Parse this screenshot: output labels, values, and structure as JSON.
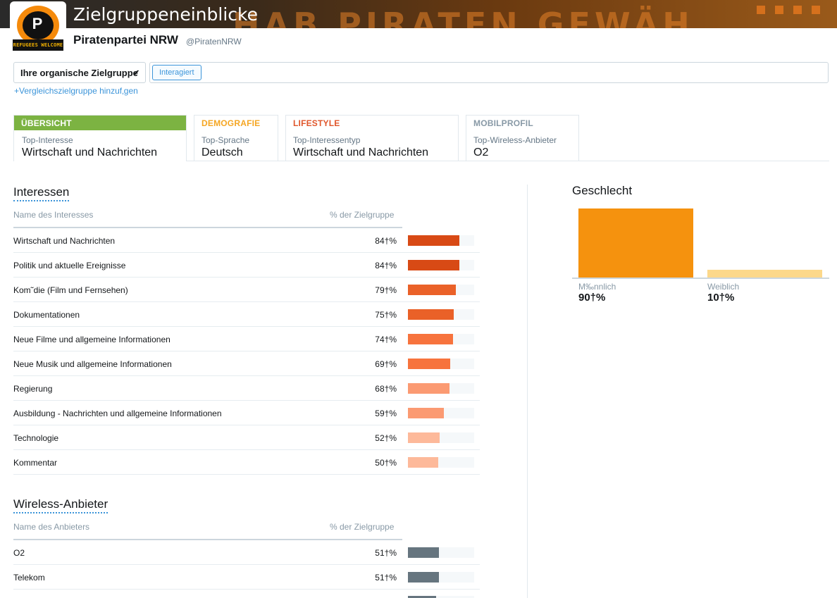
{
  "header": {
    "title": "Zielgruppeneinblicke",
    "banner_text": "HAB PIRATEN GEWÄH",
    "avatar_ribbon": "REFUGEES WELCOME",
    "account_name": "Piratenpartei NRW",
    "account_handle": "@PiratenNRW"
  },
  "filters": {
    "audience_select": "Ihre organische Zielgruppe",
    "chip": "Interagiert",
    "add_comparison": "+Vergleichszielgruppe hinzuf‚gen"
  },
  "tabs": [
    {
      "head": "ÜBERSICHT",
      "sub": "Top-Interesse",
      "value": "Wirtschaft und Nachrichten",
      "color": "#7cb342"
    },
    {
      "head": "DEMOGRAFIE",
      "sub": "Top-Sprache",
      "value": "Deutsch",
      "color": "#f5a623"
    },
    {
      "head": "LIFESTYLE",
      "sub": "Top-Interessentyp",
      "value": "Wirtschaft und Nachrichten",
      "color": "#e0562b"
    },
    {
      "head": "MOBILPROFIL",
      "sub": "Top-Wireless-Anbieter",
      "value": "O2",
      "color": "#8899a6"
    }
  ],
  "interests": {
    "title": "Interessen",
    "col_name": "Name des Interesses",
    "col_pct": "% der Zielgruppe",
    "rows": [
      {
        "name": "Wirtschaft und Nachrichten",
        "pct": "84†%",
        "value": 84,
        "color": "#d84a15"
      },
      {
        "name": "Politik und aktuelle Ereignisse",
        "pct": "84†%",
        "value": 84,
        "color": "#d84a15"
      },
      {
        "name": "Kom˜die (Film und Fernsehen)",
        "pct": "79†%",
        "value": 79,
        "color": "#ea6128"
      },
      {
        "name": "Dokumentationen",
        "pct": "75†%",
        "value": 75,
        "color": "#ea6128"
      },
      {
        "name": "Neue Filme und allgemeine Informationen",
        "pct": "74†%",
        "value": 74,
        "color": "#f7733d"
      },
      {
        "name": "Neue Musik und allgemeine Informationen",
        "pct": "69†%",
        "value": 69,
        "color": "#f7733d"
      },
      {
        "name": "Regierung",
        "pct": "68†%",
        "value": 68,
        "color": "#fb9a72"
      },
      {
        "name": "Ausbildung - Nachrichten und allgemeine Informationen",
        "pct": "59†%",
        "value": 59,
        "color": "#fb9a72"
      },
      {
        "name": "Technologie",
        "pct": "52†%",
        "value": 52,
        "color": "#fdb99a"
      },
      {
        "name": "Kommentar",
        "pct": "50†%",
        "value": 50,
        "color": "#fdb99a"
      }
    ]
  },
  "wireless": {
    "title": "Wireless-Anbieter",
    "col_name": "Name des Anbieters",
    "col_pct": "% der Zielgruppe",
    "rows": [
      {
        "name": "O2",
        "pct": "51†%",
        "value": 51,
        "color": "#66757f"
      },
      {
        "name": "Telekom",
        "pct": "51†%",
        "value": 51,
        "color": "#66757f"
      }
    ],
    "partial_row_value": 46
  },
  "chart_data": {
    "type": "bar",
    "title": "Geschlecht",
    "categories": [
      "M‰nnlich",
      "Weiblich"
    ],
    "values": [
      90,
      10
    ],
    "value_labels": [
      "90†%",
      "10†%"
    ],
    "colors": [
      "#f5920e",
      "#fcd88a"
    ],
    "ylim": [
      0,
      90
    ]
  }
}
